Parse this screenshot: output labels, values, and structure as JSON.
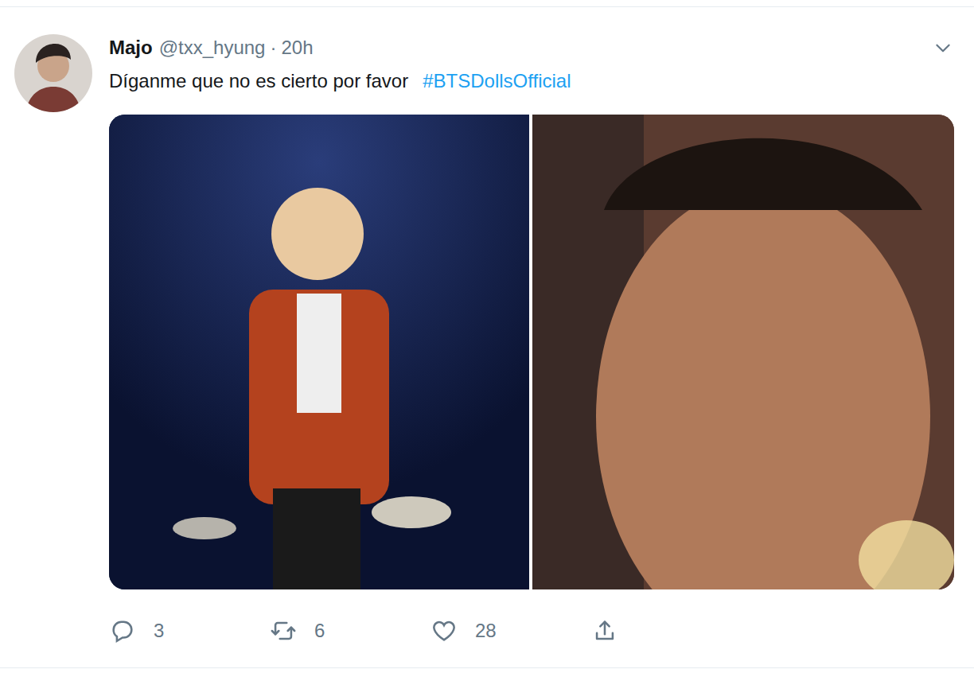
{
  "tweet": {
    "author": {
      "name": "Majo",
      "handle": "@txx_hyung",
      "separator": "·",
      "time": "20h"
    },
    "text": "Díganme que no es cierto por favor",
    "hashtag": "#BTSDollsOfficial",
    "actions": [
      {
        "kind": "reply",
        "count": "3"
      },
      {
        "kind": "retweet",
        "count": "6"
      },
      {
        "kind": "like",
        "count": "28"
      },
      {
        "kind": "share",
        "count": ""
      }
    ]
  }
}
